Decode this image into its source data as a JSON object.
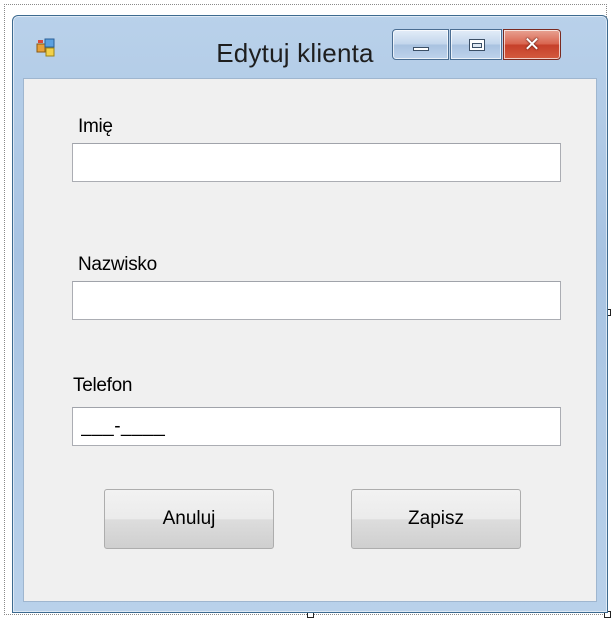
{
  "window": {
    "title": "Edytuj klienta",
    "caption_buttons": {
      "minimize_icon": "minimize-icon",
      "maximize_icon": "maximize-icon",
      "close_glyph": "✕"
    },
    "colors": {
      "frame": "#b9d1ea",
      "client": "#f0f0f0",
      "close": "#c5402a"
    }
  },
  "form": {
    "first_name": {
      "label": "Imię",
      "value": ""
    },
    "last_name": {
      "label": "Nazwisko",
      "value": ""
    },
    "phone": {
      "label": "Telefon",
      "value": "___-____"
    }
  },
  "buttons": {
    "cancel": "Anuluj",
    "save": "Zapisz"
  }
}
